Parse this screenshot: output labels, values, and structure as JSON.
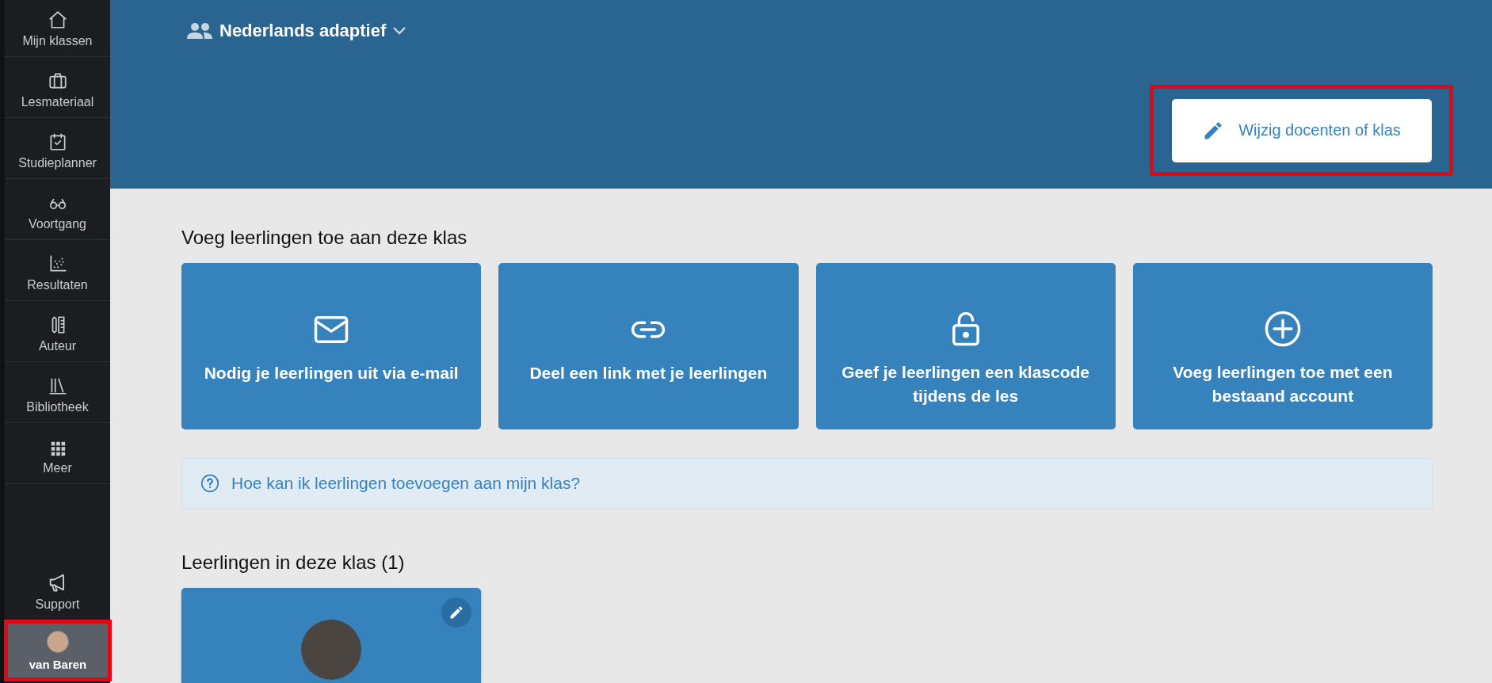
{
  "sidebar": {
    "items": [
      {
        "label": "Mijn klassen"
      },
      {
        "label": "Lesmateriaal"
      },
      {
        "label": "Studieplanner"
      },
      {
        "label": "Voortgang"
      },
      {
        "label": "Resultaten"
      },
      {
        "label": "Auteur"
      },
      {
        "label": "Bibliotheek"
      },
      {
        "label": "Meer"
      }
    ],
    "support": {
      "label": "Support"
    },
    "user": {
      "name": "van Baren"
    }
  },
  "header": {
    "class_name": "Nederlands adaptief",
    "edit_button": "Wijzig docenten of klas"
  },
  "add_section": {
    "title": "Voeg leerlingen toe aan deze klas",
    "options": [
      {
        "label": "Nodig je leerlingen uit via e-mail"
      },
      {
        "label": "Deel een link met je leerlingen"
      },
      {
        "label": "Geef je leerlingen een klascode tijdens de les"
      },
      {
        "label": "Voeg leerlingen toe met een bestaand account"
      }
    ]
  },
  "help_link": "Hoe kan ik leerlingen toevoegen aan mijn klas?",
  "students_section": {
    "title": "Leerlingen in deze klas (1)"
  }
}
